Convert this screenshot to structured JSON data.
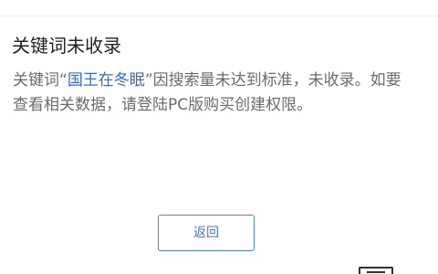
{
  "header": {
    "title": ""
  },
  "notice": {
    "title": "关键词未收录",
    "body_prefix": "关键词",
    "open_quote": "“",
    "keyword": "国王在冬眠",
    "close_quote": "”",
    "body_suffix": "因搜索量未达到标准，未收录。如要查看相关数据，请登陆PC版购买创建权限。"
  },
  "actions": {
    "back_label": "返回"
  },
  "icons": {
    "corner_widget": "keyboard-icon"
  },
  "colors": {
    "keyword": "#2f6dd3",
    "button_border": "#4a86d8",
    "button_text": "#3c78d8",
    "body_text": "#6b6b6b",
    "title_text": "#222222"
  }
}
